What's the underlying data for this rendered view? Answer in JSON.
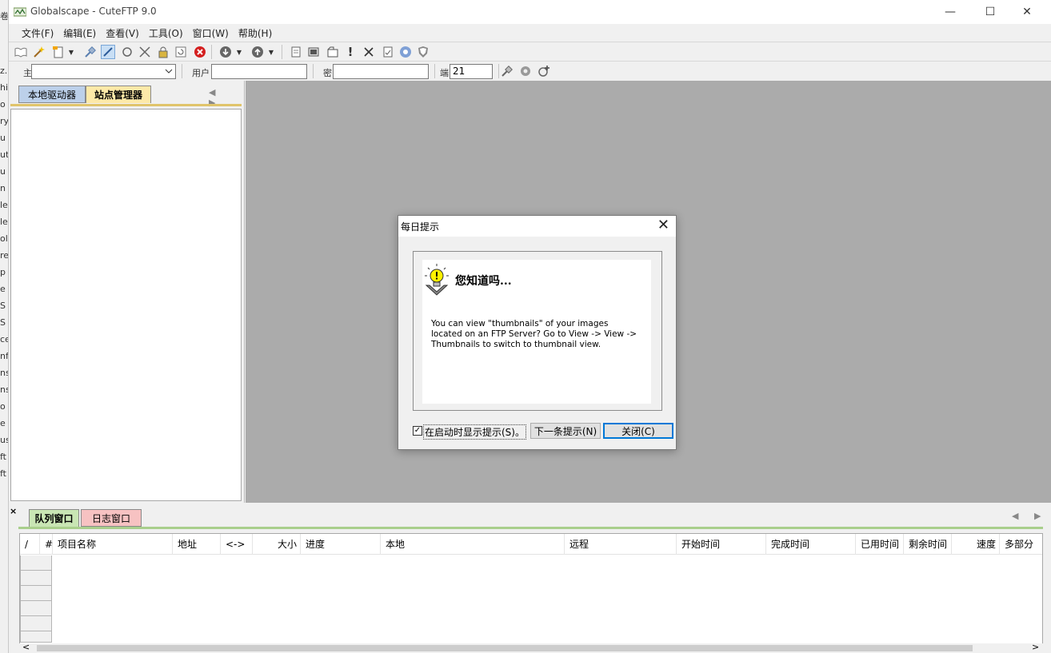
{
  "window": {
    "title": "Globalscape - CuteFTP 9.0",
    "minimize": "—",
    "maximize": "☐",
    "close": "✕"
  },
  "background_window_chars": [
    "卷",
    "z.",
    "hi",
    "o",
    "ry",
    "u",
    "ut",
    "u",
    "n",
    "le",
    "le",
    "ol",
    "re",
    "p",
    "e",
    "S",
    "S",
    "ce",
    "nf",
    "ns",
    "ns",
    "o",
    "e",
    "us",
    "ft",
    "ft"
  ],
  "menu": [
    "文件(F)",
    "编辑(E)",
    "查看(V)",
    "工具(O)",
    "窗口(W)",
    "帮助(H)"
  ],
  "toolbar2": {
    "host_label": "主",
    "host_value": "",
    "user_label": "用户",
    "user_value": "",
    "password_label": "密",
    "password_value": "",
    "port_label": "端",
    "port_value": "21"
  },
  "left_panel": {
    "tabs": [
      "本地驱动器",
      "站点管理器"
    ],
    "nav": "◀ ▶"
  },
  "bottom_panel": {
    "close": "×",
    "tabs": [
      "队列窗口",
      "日志窗口"
    ],
    "nav": "◀ ▶",
    "columns": [
      "/",
      "#",
      "项目名称",
      "地址",
      "<->",
      "大小",
      "进度",
      "本地",
      "远程",
      "开始时间",
      "完成时间",
      "已用时间",
      "剩余时间",
      "速度",
      "多部分"
    ],
    "scroll_left": "<",
    "scroll_right": ">"
  },
  "dialog": {
    "title": "每日提示",
    "close": "✕",
    "heading": "您知道吗...",
    "tip": "You can view \"thumbnails\" of your images located on an FTP Server? Go to View -> View -> Thumbnails to switch to thumbnail view.",
    "checkbox_checked": true,
    "checkbox_mark": "✓",
    "checkbox_label": "在启动时显示提示(S)。",
    "next_button": "下一条提示(N)",
    "close_button": "关闭(C)"
  },
  "colors": {
    "mdi_background": "#ababab",
    "site_tab": "#fde9a8",
    "local_tab": "#bcd0ea",
    "queue_tab": "#c9e6b4",
    "log_tab": "#f7c2c2",
    "focus_border": "#0078d7"
  }
}
